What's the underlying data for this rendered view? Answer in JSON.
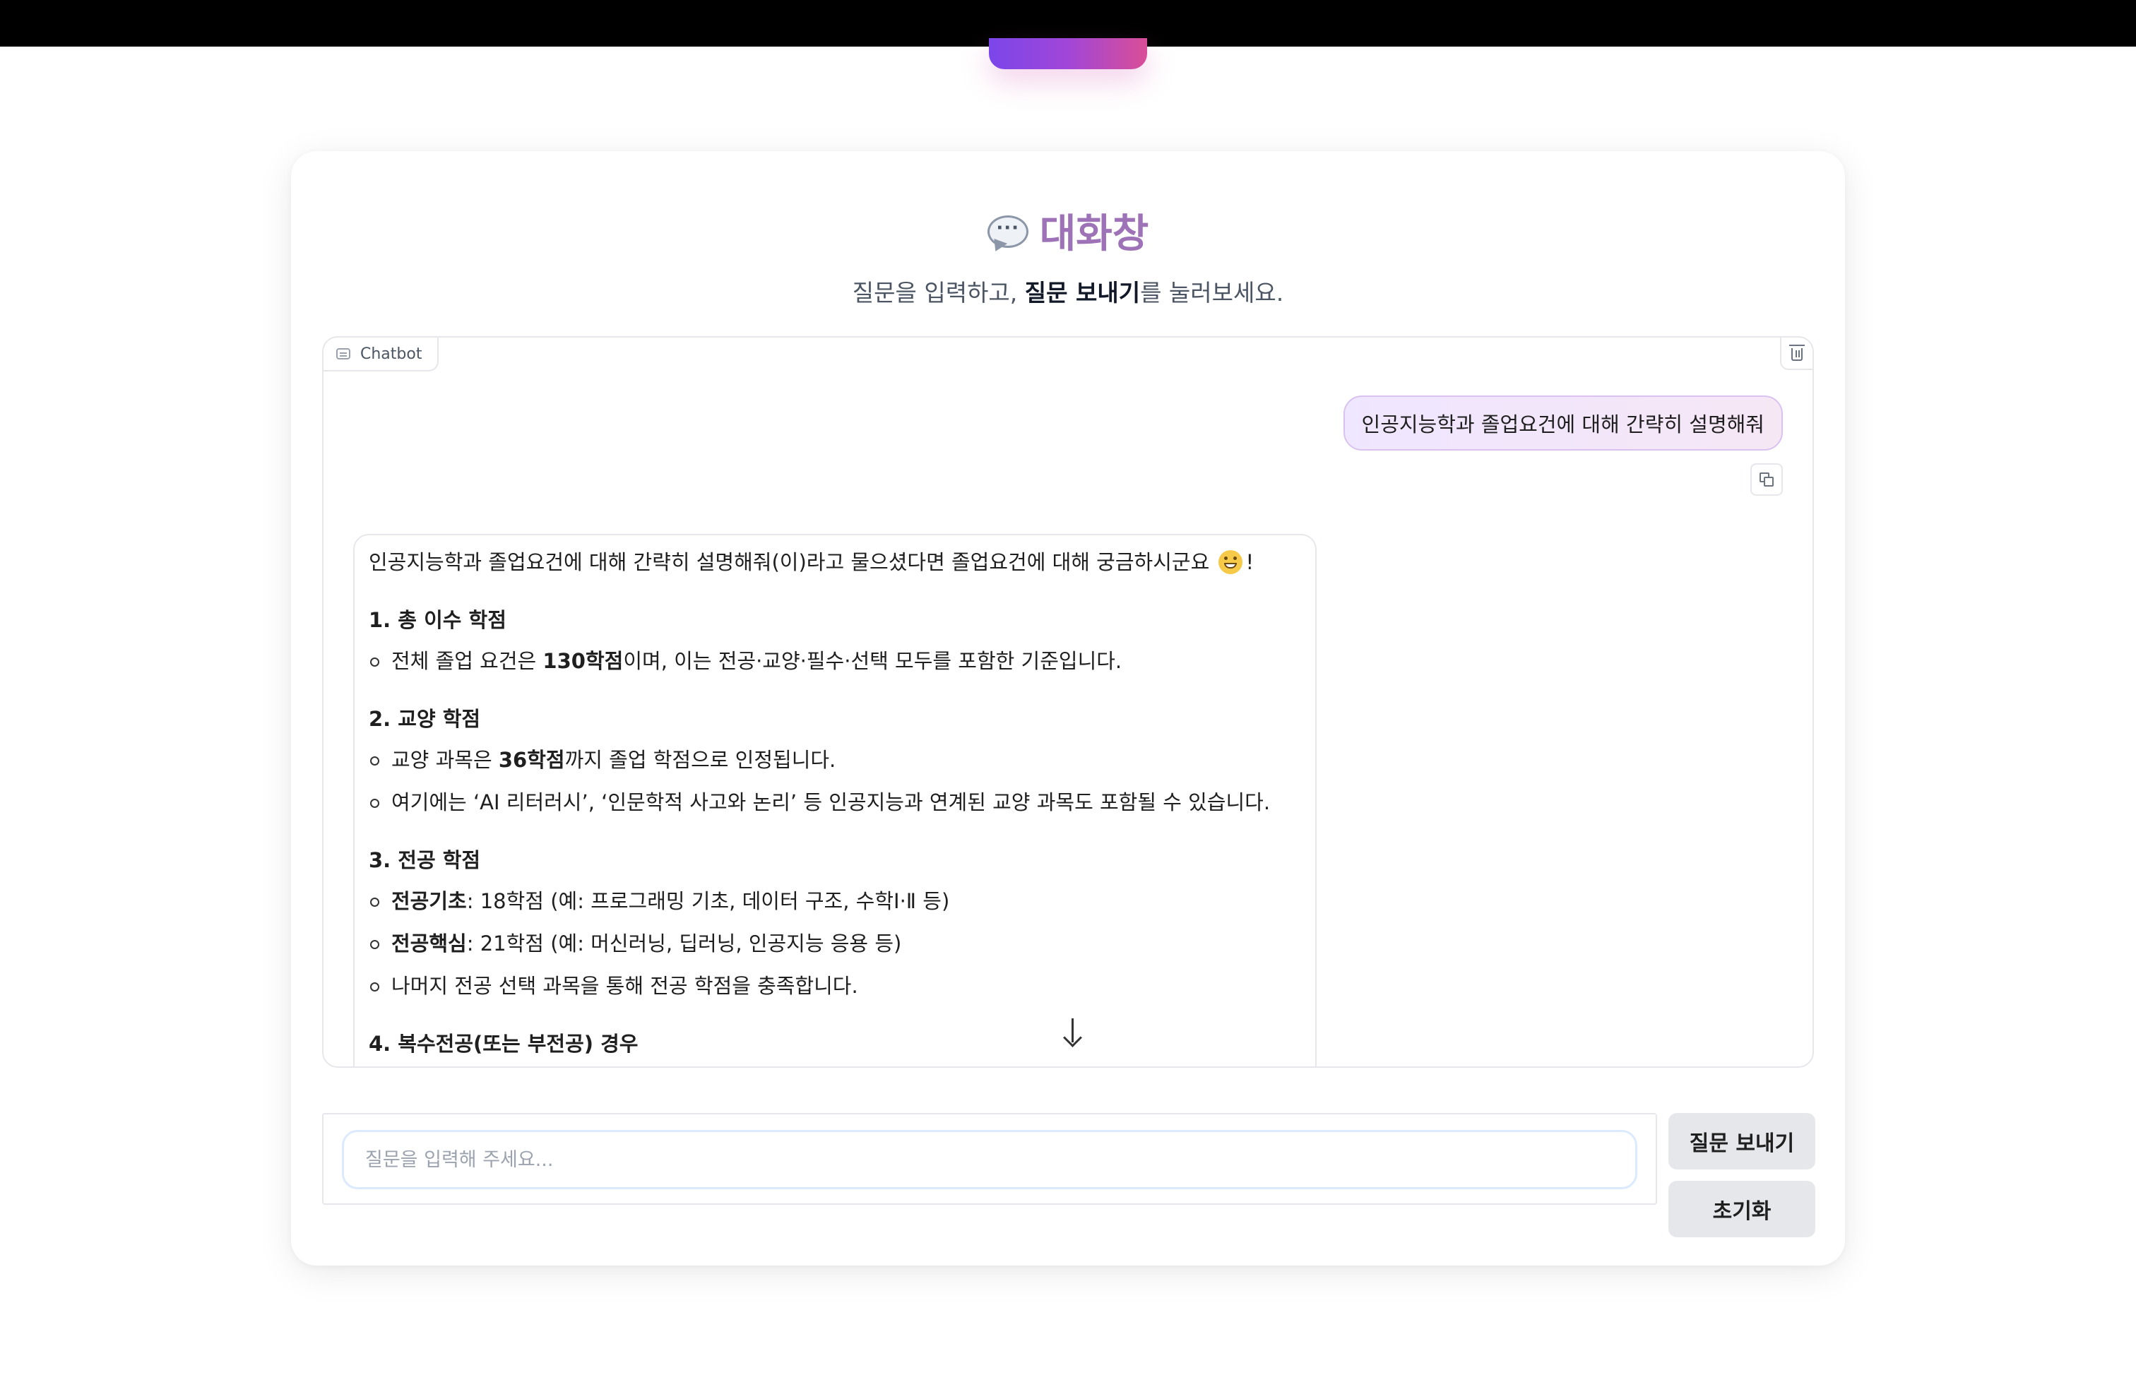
{
  "header": {
    "title": "대화창",
    "title_icon": "speech-bubble-icon",
    "subtitle_prefix": "질문을 입력하고, ",
    "subtitle_bold": "질문 보내기",
    "subtitle_suffix": "를 눌러보세요."
  },
  "chatbot": {
    "label": "Chatbot",
    "user_message": "인공지능학과 졸업요건에 대해 간략히 설명해줘",
    "bot_intro_before": "인공지능학과 졸업요건에 대해 간략히 설명해줘(이)라고 물으셨다면 졸업요건에 대해 궁금하시군요",
    "bot_intro_after": "!",
    "sections": [
      {
        "heading": "1. 총 이수 학점",
        "items": [
          {
            "pre": "전체 졸업 요건은 ",
            "bold": "130학점",
            "post": "이며, 이는 전공·교양·필수·선택 모두를 포함한 기준입니다."
          }
        ]
      },
      {
        "heading": "2. 교양 학점",
        "items": [
          {
            "pre": "교양 과목은 ",
            "bold": "36학점",
            "post": "까지 졸업 학점으로 인정됩니다."
          },
          {
            "pre": "여기에는 ‘AI 리터러시’, ‘인문학적 사고와 논리’ 등 인공지능과 연계된 교양 과목도 포함될 수 있습니다.",
            "bold": "",
            "post": ""
          }
        ]
      },
      {
        "heading": "3. 전공 학점",
        "items": [
          {
            "pre": "",
            "bold": "전공기초",
            "post": ": 18학점 (예: 프로그래밍 기초, 데이터 구조, 수학Ⅰ·Ⅱ 등)"
          },
          {
            "pre": "",
            "bold": "전공핵심",
            "post": ": 21학점 (예: 머신러닝, 딥러닝, 인공지능 응용 등)"
          },
          {
            "pre": "나머지 전공 선택 과목을 통해 전공 학점을 충족합니다.",
            "bold": "",
            "post": ""
          }
        ]
      },
      {
        "heading": "4. 복수전공(또는 부전공) 경우",
        "items": []
      }
    ]
  },
  "input": {
    "placeholder": "질문을 입력해 주세요...",
    "value": ""
  },
  "buttons": {
    "send_label": "질문 보내기",
    "reset_label": "초기화"
  },
  "colors": {
    "title": "#9e72b7",
    "user_bubble": "#efe6ff",
    "gradient_start": "#7b46ea",
    "gradient_end": "#d94e97",
    "button_bg": "#e5e7eb"
  }
}
